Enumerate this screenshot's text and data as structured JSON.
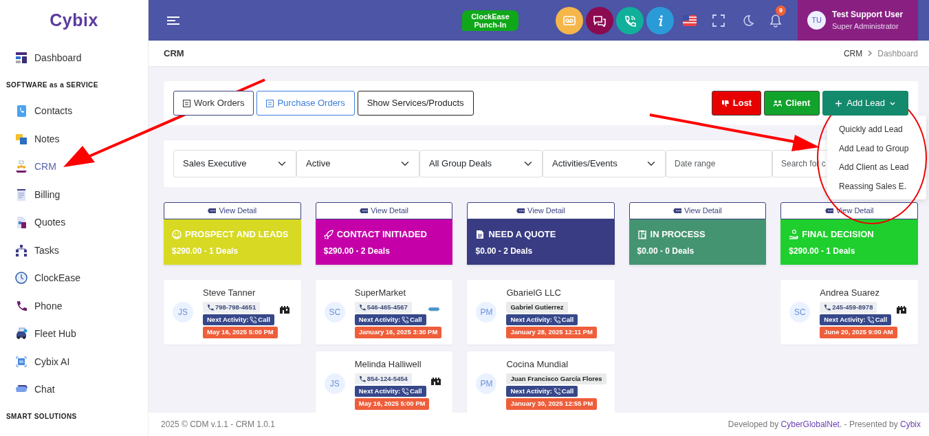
{
  "sidebar": {
    "logo": "Cybix",
    "items": [
      {
        "kind": "item",
        "label": "Dashboard",
        "selected": false
      },
      {
        "kind": "section",
        "label": "SOFTWARE as a SERVICE"
      },
      {
        "kind": "item",
        "label": "Contacts",
        "selected": false
      },
      {
        "kind": "item",
        "label": "Notes",
        "selected": false
      },
      {
        "kind": "item",
        "label": "CRM",
        "selected": true
      },
      {
        "kind": "item",
        "label": "Billing",
        "selected": false
      },
      {
        "kind": "item",
        "label": "Quotes",
        "selected": false
      },
      {
        "kind": "item",
        "label": "Tasks",
        "selected": false
      },
      {
        "kind": "item",
        "label": "ClockEase",
        "selected": false
      },
      {
        "kind": "item",
        "label": "Phone",
        "selected": false
      },
      {
        "kind": "item",
        "label": "Fleet Hub",
        "selected": false
      },
      {
        "kind": "item",
        "label": "Cybix AI",
        "selected": false
      },
      {
        "kind": "item",
        "label": "Chat",
        "selected": false
      },
      {
        "kind": "section",
        "label": "SMART SOLUTIONS"
      }
    ]
  },
  "topbar": {
    "punch_button": "ClockEase Punch-In",
    "notification_count": "9",
    "user": {
      "initials": "TU",
      "name": "Test Support User",
      "role": "Super Administrator"
    }
  },
  "page": {
    "title": "CRM",
    "breadcrumb": [
      "CRM",
      "Dashboard"
    ]
  },
  "toolbar": {
    "left_buttons": [
      {
        "label": "Work Orders",
        "kind": "dark"
      },
      {
        "label": "Purchase Orders",
        "kind": "blue"
      },
      {
        "label": "Show Services/Products",
        "kind": "plain"
      }
    ],
    "right_buttons": [
      {
        "label": "Lost",
        "kind": "lost"
      },
      {
        "label": "Client",
        "kind": "client"
      }
    ],
    "add_lead": {
      "label": "Add Lead",
      "expanded": true,
      "menu": [
        "Quickly add Lead",
        "Add Lead to Group",
        "Add Client as Lead",
        "Reassing Sales E."
      ]
    }
  },
  "filters": {
    "selects": [
      "Sales Executive",
      "Active",
      "All Group Deals",
      "Activities/Events"
    ],
    "date": {
      "placeholder": "Date range"
    },
    "search": {
      "placeholder": "Search for c"
    }
  },
  "stages": [
    {
      "view_button": "View Detail",
      "title": "PROSPECT AND LEADS",
      "total": "$290.00 - 1 Deals",
      "color": "#d7d922",
      "cards": [
        {
          "kind": "store",
          "initials": "JS",
          "name": "Steve Tanner",
          "phone": "798-798-4651",
          "activity_label": "Next Activity:",
          "activity": "Call",
          "date": "May 16, 2025 5:00 PM"
        }
      ]
    },
    {
      "view_button": "View Detail",
      "title": "CONTACT INITIADED",
      "total": "$290.00 - 2 Deals",
      "color": "#c600a9",
      "cards": [
        {
          "kind": "boat",
          "initials": "SC",
          "name": "SuperMarket",
          "phone": "546-465-4567",
          "activity_label": "Next Activity:",
          "activity": "Call",
          "date": "January 16, 2025 3:30 PM"
        },
        {
          "kind": "store",
          "initials": "JS",
          "name": "Melinda Halliwell",
          "phone": "854-124-5454",
          "activity_label": "Next Activity:",
          "activity": "Call",
          "date": "May 16, 2025 5:00 PM"
        }
      ]
    },
    {
      "view_button": "View Detail",
      "title": "NEED A QUOTE",
      "total": "$0.00 - 2 Deals",
      "color": "#393c82",
      "cards": [
        {
          "kind": "plain",
          "initials": "PM",
          "name": "GbarielG LLC",
          "contact": "Gabriel Gutierrez",
          "activity_label": "Next Activity:",
          "activity": "Call",
          "date": "January 28, 2025 12:11 PM"
        },
        {
          "kind": "plain",
          "initials": "PM",
          "name": "Cocina Mundial",
          "contact": "Juan Francisco García Flores",
          "activity_label": "Next Activity:",
          "activity": "Call",
          "date": "January 30, 2025 12:55 PM"
        }
      ]
    },
    {
      "view_button": "View Detail",
      "title": "IN PROCESS",
      "total": "$0.00 - 0 Deals",
      "color": "#459471"
    },
    {
      "view_button": "View Detail",
      "title": "FINAL DECISION",
      "total": "$290.00 - 1 Deals",
      "color": "#1fcf2d",
      "cards": [
        {
          "kind": "store",
          "initials": "SC",
          "name": "Andrea Suarez",
          "phone": "245-459-8978",
          "activity_label": "Next Activity:",
          "activity": "Call",
          "date": "June 20, 2025 9:00 AM"
        }
      ]
    }
  ],
  "footer": {
    "left": "2025 © CDM v.1.1 - CRM 1.0.1",
    "credit": [
      {
        "text": "Developed by ",
        "kind": "text"
      },
      {
        "text": "CyberGlobalNet",
        "kind": "link"
      },
      {
        "text": ". - Presented by ",
        "kind": "text"
      },
      {
        "text": "Cybix",
        "kind": "link"
      }
    ]
  }
}
